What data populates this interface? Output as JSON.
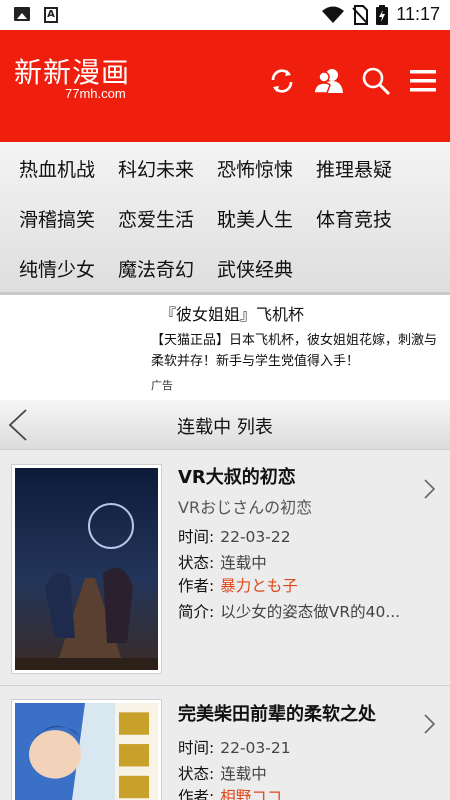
{
  "status_bar": {
    "time": "11:17",
    "icons": [
      "image-icon",
      "a-box-icon",
      "wifi-icon",
      "no-sim-icon",
      "battery-icon"
    ]
  },
  "header": {
    "logo_title": "新新漫画",
    "logo_sub": "77mh.com",
    "icons": [
      "refresh-icon",
      "user-icon",
      "search-icon",
      "menu-icon"
    ],
    "bg_color": "#f01e0c"
  },
  "categories": [
    [
      "热血机战",
      "科幻未来",
      "恐怖惊悚",
      "推理悬疑"
    ],
    [
      "滑稽搞笑",
      "恋爱生活",
      "耽美人生",
      "体育竞技"
    ],
    [
      "纯情少女",
      "魔法奇幻",
      "武侠经典"
    ]
  ],
  "ad": {
    "title": "『彼女姐姐』飞机杯",
    "body": "【天猫正品】日本飞机杯，彼女姐姐花嫁，刺激与柔软并存！新手与学生党值得入手！",
    "tag": "广告"
  },
  "list_bar": {
    "title": "连载中 列表"
  },
  "labels": {
    "time": "时间:",
    "status": "状态:",
    "author": "作者:",
    "intro": "简介:"
  },
  "items": [
    {
      "title": "VR大叔的初恋",
      "subtitle": "VRおじさんの初恋",
      "time": "22-03-22",
      "status": "连载中",
      "author": "暴力とも子",
      "intro": "以少女的姿态做VR的40..."
    },
    {
      "title": "完美柴田前辈的柔软之处",
      "time": "22-03-21",
      "status": "连载中",
      "author": "相野ココ"
    }
  ],
  "colors": {
    "author": "#e0481a",
    "accent": "#f01e0c"
  }
}
